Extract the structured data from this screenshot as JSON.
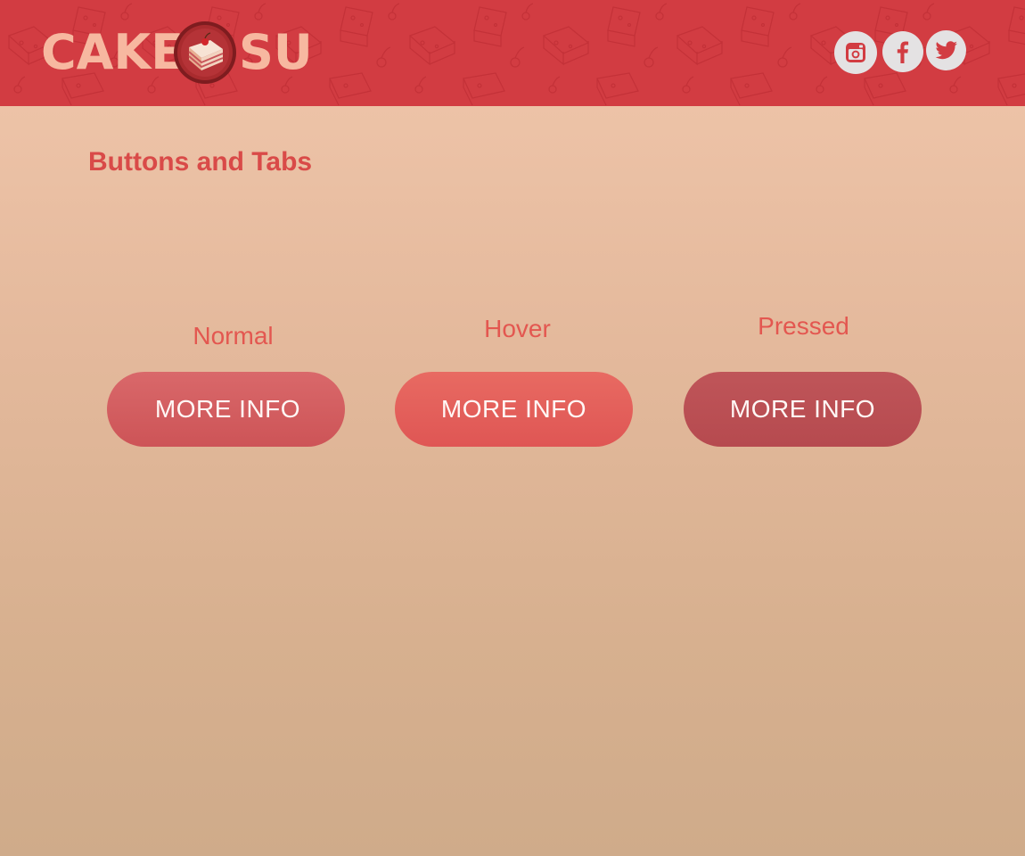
{
  "header": {
    "logo": {
      "text_left": "CAKE",
      "text_right": "SU",
      "emblem_icon": "cake-slice-icon"
    },
    "social": [
      {
        "name": "Instagram",
        "icon": "instagram-icon"
      },
      {
        "name": "Facebook",
        "icon": "facebook-icon"
      },
      {
        "name": "Twitter",
        "icon": "twitter-icon"
      }
    ],
    "background_color": "#d23c42"
  },
  "page": {
    "title": "Buttons and Tabs"
  },
  "states": [
    {
      "label": "Normal",
      "button_label": "MORE INFO",
      "color": "#d35e61"
    },
    {
      "label": "Hover",
      "button_label": "MORE INFO",
      "color": "#e4605c"
    },
    {
      "label": "Pressed",
      "button_label": "MORE INFO",
      "color": "#bb4f53"
    }
  ],
  "colors": {
    "accent": "#d94a48",
    "label": "#e35750",
    "button_text": "#fff7f5",
    "social_bg": "#e4e2e3",
    "social_glyph": "#d23c42"
  }
}
